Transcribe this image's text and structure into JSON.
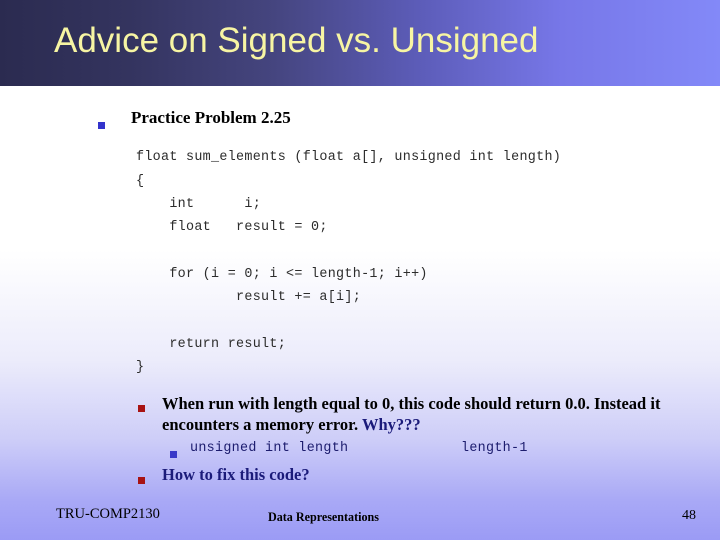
{
  "slide": {
    "title": "Advice on Signed vs. Unsigned",
    "title_color": "#f7f5a3",
    "band_gradient_from": "#2b2b50",
    "band_gradient_to": "#8389f8",
    "body_gradient_from": "#ffffff",
    "body_gradient_to": "#9b9bf5"
  },
  "heading": {
    "label": "Practice Problem 2.25",
    "bullet_icon": "blue-square-bullet",
    "bullet_color": "#3333cc"
  },
  "code": {
    "text": "float sum_elements (float a[], unsigned int length)\n{\n    int      i;\n    float   result = 0;\n\n    for (i = 0; i <= length-1; i++)\n            result += a[i];\n\n    return result;\n}",
    "color": "#2c2c2c"
  },
  "notes": {
    "problem_bullet_icon": "red-square-bullet",
    "problem_bullet_color": "#a81313",
    "problem_text_lead": "When run with length equal to 0, this code should return 0.0. Instead it encounters a memory error. ",
    "problem_text_emphasis": "Why???",
    "problem_emphasis_color": "#1b1b7a",
    "sub_bullet_icon": "blue-square-bullet",
    "sub_bullet_color": "#3a3ac8",
    "sub_code_left": "unsigned int length",
    "sub_code_right": "length-1",
    "sub_code_color": "#1c1c6e",
    "fix_bullet_icon": "red-square-bullet",
    "fix_bullet_color": "#a81313",
    "fix_text": "How to fix this code?",
    "fix_text_color": "#1b1b7a"
  },
  "footer": {
    "course": "TRU-COMP2130",
    "topic": "Data Representations",
    "page_number": "48"
  }
}
